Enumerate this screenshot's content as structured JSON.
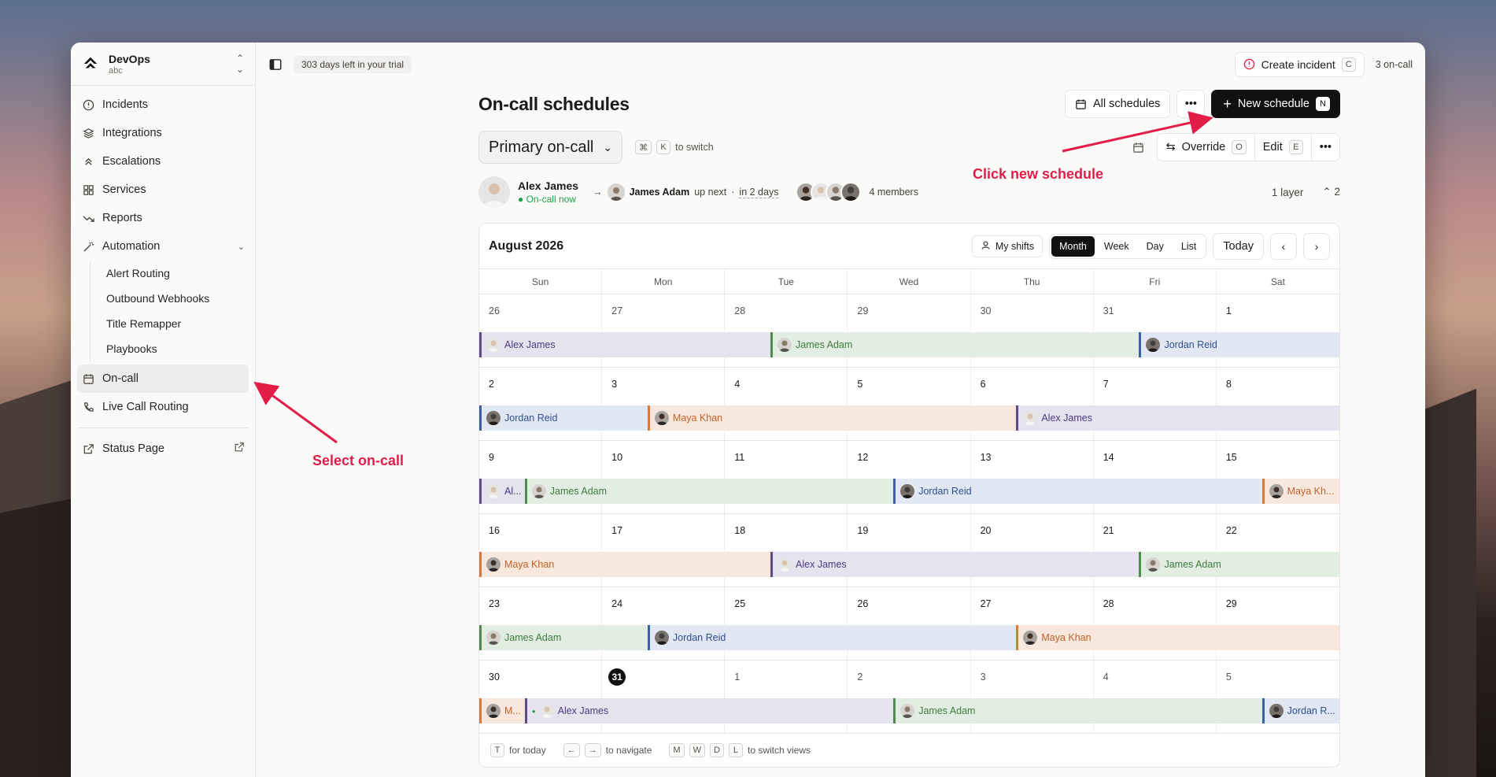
{
  "org": {
    "name": "DevOps",
    "sub": "abc"
  },
  "topbar": {
    "trial": "303 days left in your trial",
    "create_incident": "Create incident",
    "create_incident_key": "C",
    "oncall_count": "3 on-call"
  },
  "sidebar": {
    "items": [
      {
        "label": "Incidents",
        "icon": "alert-circle-icon"
      },
      {
        "label": "Integrations",
        "icon": "layers-icon"
      },
      {
        "label": "Escalations",
        "icon": "chevrons-up-icon"
      },
      {
        "label": "Services",
        "icon": "grid-icon"
      },
      {
        "label": "Reports",
        "icon": "trend-down-icon"
      },
      {
        "label": "Automation",
        "icon": "wand-icon"
      }
    ],
    "automation_sub": [
      "Alert Routing",
      "Outbound Webhooks",
      "Title Remapper",
      "Playbooks"
    ],
    "oncall": "On-call",
    "live_call": "Live Call Routing",
    "status_page": "Status Page"
  },
  "page": {
    "title": "On-call schedules",
    "all_schedules": "All schedules",
    "new_schedule": "New schedule",
    "new_schedule_key": "N",
    "schedule_name": "Primary on-call",
    "switch_keys": [
      "⌘",
      "K"
    ],
    "switch_hint": "to switch",
    "override": "Override",
    "override_key": "O",
    "edit": "Edit",
    "edit_key": "E"
  },
  "oncall_now": {
    "name": "Alex James",
    "status": "On-call now"
  },
  "next_up": {
    "name": "James Adam",
    "suffix": "up next",
    "sep": "·",
    "when": "in 2 days"
  },
  "members_label": "4 members",
  "layers_label": "1 layer",
  "escalation_count": "2",
  "calendar": {
    "month": "August 2026",
    "my_shifts": "My shifts",
    "views": [
      "Month",
      "Week",
      "Day",
      "List"
    ],
    "selected_view": "Month",
    "today": "Today",
    "dow": [
      "Sun",
      "Mon",
      "Tue",
      "Wed",
      "Thu",
      "Fri",
      "Sat"
    ],
    "weeks": [
      {
        "days": [
          "26",
          "27",
          "28",
          "29",
          "30",
          "31",
          "1"
        ],
        "other": [
          0,
          1,
          2,
          3,
          4,
          5
        ],
        "bars": [
          {
            "who": "alex",
            "label": "Alex James",
            "start": 0,
            "end": 2.37
          },
          {
            "who": "james",
            "label": "James Adam",
            "start": 2.37,
            "end": 5.37
          },
          {
            "who": "jordan",
            "label": "Jordan Reid",
            "start": 5.37,
            "end": 7
          }
        ]
      },
      {
        "days": [
          "2",
          "3",
          "4",
          "5",
          "6",
          "7",
          "8"
        ],
        "other": [],
        "bars": [
          {
            "who": "jordan",
            "label": "Jordan Reid",
            "start": 0,
            "end": 1.37
          },
          {
            "who": "maya",
            "label": "Maya Khan",
            "start": 1.37,
            "end": 4.37
          },
          {
            "who": "alex",
            "label": "Alex James",
            "start": 4.37,
            "end": 7
          }
        ]
      },
      {
        "days": [
          "9",
          "10",
          "11",
          "12",
          "13",
          "14",
          "15"
        ],
        "other": [],
        "bars": [
          {
            "who": "alex",
            "label": "Al...",
            "start": 0,
            "end": 0.37
          },
          {
            "who": "james",
            "label": "James Adam",
            "start": 0.37,
            "end": 3.37
          },
          {
            "who": "jordan",
            "label": "Jordan Reid",
            "start": 3.37,
            "end": 6.37
          },
          {
            "who": "maya",
            "label": "Maya Kh...",
            "start": 6.37,
            "end": 7
          }
        ]
      },
      {
        "days": [
          "16",
          "17",
          "18",
          "19",
          "20",
          "21",
          "22"
        ],
        "other": [],
        "bars": [
          {
            "who": "maya",
            "label": "Maya Khan",
            "start": 0,
            "end": 2.37
          },
          {
            "who": "alex",
            "label": "Alex James",
            "start": 2.37,
            "end": 5.37
          },
          {
            "who": "james",
            "label": "James Adam",
            "start": 5.37,
            "end": 7
          }
        ]
      },
      {
        "days": [
          "23",
          "24",
          "25",
          "26",
          "27",
          "28",
          "29"
        ],
        "other": [],
        "bars": [
          {
            "who": "james",
            "label": "James Adam",
            "start": 0,
            "end": 1.37
          },
          {
            "who": "jordan",
            "label": "Jordan Reid",
            "start": 1.37,
            "end": 4.37
          },
          {
            "who": "maya",
            "label": "Maya Khan",
            "start": 4.37,
            "end": 7
          }
        ]
      },
      {
        "days": [
          "30",
          "31",
          "1",
          "2",
          "3",
          "4",
          "5"
        ],
        "other": [
          2,
          3,
          4,
          5,
          6
        ],
        "today": 1,
        "bars": [
          {
            "who": "maya",
            "label": "M...",
            "start": 0,
            "end": 0.37
          },
          {
            "who": "alex",
            "label": "Alex James",
            "start": 0.37,
            "end": 3.37,
            "dot": true
          },
          {
            "who": "james",
            "label": "James Adam",
            "start": 3.37,
            "end": 6.37
          },
          {
            "who": "jordan",
            "label": "Jordan R...",
            "start": 6.37,
            "end": 7
          }
        ]
      }
    ],
    "footer": {
      "today_key": "T",
      "today_text": "for today",
      "nav_keys": [
        "←",
        "→"
      ],
      "nav_text": "to navigate",
      "view_keys": [
        "M",
        "W",
        "D",
        "L"
      ],
      "view_text": "to switch views"
    }
  },
  "annotations": {
    "new_schedule": "Click new schedule",
    "oncall": "Select on-call"
  },
  "colors": {
    "accent": "#e11d48",
    "alex": "#5b4b8a",
    "james": "#4f8a4f",
    "jordan": "#3b5fa0",
    "maya": "#d97a3a"
  }
}
